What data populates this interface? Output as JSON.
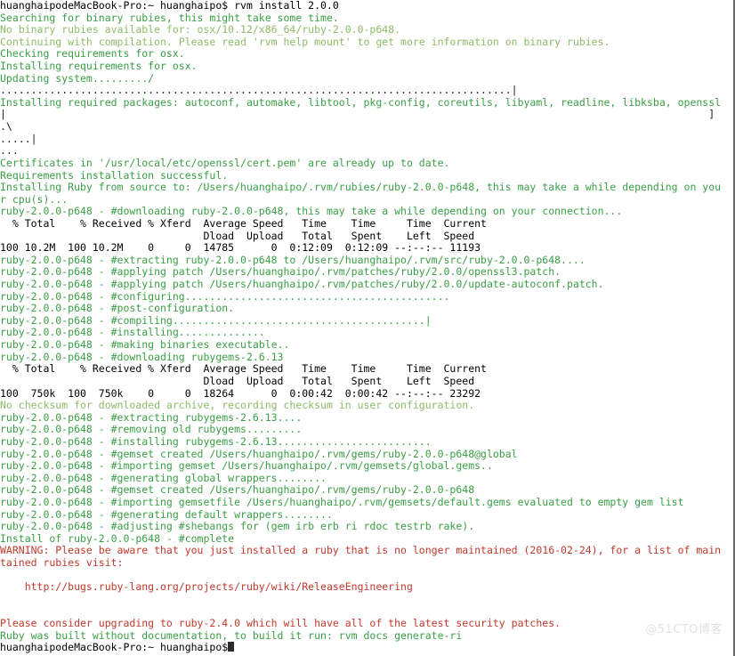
{
  "terminal": {
    "app": "Terminal",
    "prompt_user": "huanghaipo",
    "prompt_host": "huanghaipodeMacBook-Pro",
    "command": "rvm install 2.0.0",
    "watermark": "@51CTO博客",
    "colors": {
      "background": "#ffffff",
      "default_text": "#000000",
      "info_green": "#3a9e45",
      "notice_yellow_green": "#8dbb67",
      "warning_red": "#c0392b"
    },
    "lines": [
      {
        "color": "black",
        "text": "huanghaipodeMacBook-Pro:~ huanghaipo$ rvm install 2.0.0"
      },
      {
        "color": "green",
        "text": "Searching for binary rubies, this might take some time."
      },
      {
        "color": "lgreen",
        "text": "No binary rubies available for: osx/10.12/x86_64/ruby-2.0.0-p648."
      },
      {
        "color": "lgreen",
        "text": "Continuing with compilation. Please read 'rvm help mount' to get more information on binary rubies."
      },
      {
        "color": "green",
        "text": "Checking requirements for osx."
      },
      {
        "color": "green",
        "text": "Installing requirements for osx."
      },
      {
        "color": "green",
        "text": "Updating system........./"
      },
      {
        "color": "dark",
        "text": "...................................................................................|"
      },
      {
        "color": "green",
        "text": "Installing required packages: autoconf, automake, libtool, pkg-config, coreutils, libyaml, readline, libksba, openssl"
      },
      {
        "color": "dark",
        "text": "|                                                                                                                  ]"
      },
      {
        "color": "dark",
        "text": ".\\"
      },
      {
        "color": "dark",
        "text": ".....|"
      },
      {
        "color": "dark",
        "text": "..."
      },
      {
        "color": "green",
        "text": "Certificates in '/usr/local/etc/openssl/cert.pem' are already up to date."
      },
      {
        "color": "green",
        "text": "Requirements installation successful."
      },
      {
        "color": "green",
        "text": "Installing Ruby from source to: /Users/huanghaipo/.rvm/rubies/ruby-2.0.0-p648, this may take a while depending on you"
      },
      {
        "color": "green",
        "text": "r cpu(s)..."
      },
      {
        "color": "green",
        "text": "ruby-2.0.0-p648 - #downloading ruby-2.0.0-p648, this may take a while depending on your connection..."
      },
      {
        "color": "black",
        "text": "  % Total    % Received % Xferd  Average Speed   Time    Time     Time  Current"
      },
      {
        "color": "black",
        "text": "                                 Dload  Upload   Total   Spent    Left  Speed"
      },
      {
        "color": "black",
        "text": "100 10.2M  100 10.2M    0     0  14785      0  0:12:09  0:12:09 --:--:-- 11193"
      },
      {
        "color": "green",
        "text": "ruby-2.0.0-p648 - #extracting ruby-2.0.0-p648 to /Users/huanghaipo/.rvm/src/ruby-2.0.0-p648...."
      },
      {
        "color": "green",
        "text": "ruby-2.0.0-p648 - #applying patch /Users/huanghaipo/.rvm/patches/ruby/2.0.0/openssl3.patch."
      },
      {
        "color": "green",
        "text": "ruby-2.0.0-p648 - #applying patch /Users/huanghaipo/.rvm/patches/ruby/2.0.0/update-autoconf.patch."
      },
      {
        "color": "green",
        "text": "ruby-2.0.0-p648 - #configuring..........................................."
      },
      {
        "color": "green",
        "text": "ruby-2.0.0-p648 - #post-configuration."
      },
      {
        "color": "green",
        "text": "ruby-2.0.0-p648 - #compiling.........................................|"
      },
      {
        "color": "green",
        "text": "ruby-2.0.0-p648 - #installing.............."
      },
      {
        "color": "green",
        "text": "ruby-2.0.0-p648 - #making binaries executable.."
      },
      {
        "color": "green",
        "text": "ruby-2.0.0-p648 - #downloading rubygems-2.6.13"
      },
      {
        "color": "black",
        "text": "  % Total    % Received % Xferd  Average Speed   Time    Time     Time  Current"
      },
      {
        "color": "black",
        "text": "                                 Dload  Upload   Total   Spent    Left  Speed"
      },
      {
        "color": "black",
        "text": "100  750k  100  750k    0     0  18264      0  0:00:42  0:00:42 --:--:-- 23292"
      },
      {
        "color": "lgreen",
        "text": "No checksum for downloaded archive, recording checksum in user configuration."
      },
      {
        "color": "green",
        "text": "ruby-2.0.0-p648 - #extracting rubygems-2.6.13...."
      },
      {
        "color": "green",
        "text": "ruby-2.0.0-p648 - #removing old rubygems........."
      },
      {
        "color": "green",
        "text": "ruby-2.0.0-p648 - #installing rubygems-2.6.13........................."
      },
      {
        "color": "green",
        "text": "ruby-2.0.0-p648 - #gemset created /Users/huanghaipo/.rvm/gems/ruby-2.0.0-p648@global"
      },
      {
        "color": "green",
        "text": "ruby-2.0.0-p648 - #importing gemset /Users/huanghaipo/.rvm/gemsets/global.gems.."
      },
      {
        "color": "green",
        "text": "ruby-2.0.0-p648 - #generating global wrappers........"
      },
      {
        "color": "green",
        "text": "ruby-2.0.0-p648 - #gemset created /Users/huanghaipo/.rvm/gems/ruby-2.0.0-p648"
      },
      {
        "color": "green",
        "text": "ruby-2.0.0-p648 - #importing gemsetfile /Users/huanghaipo/.rvm/gemsets/default.gems evaluated to empty gem list"
      },
      {
        "color": "green",
        "text": "ruby-2.0.0-p648 - #generating default wrappers........"
      },
      {
        "color": "green",
        "text": "ruby-2.0.0-p648 - #adjusting #shebangs for (gem irb erb ri rdoc testrb rake)."
      },
      {
        "color": "green",
        "text": "Install of ruby-2.0.0-p648 - #complete"
      },
      {
        "color": "red",
        "text": "WARNING: Please be aware that you just installed a ruby that is no longer maintained (2016-02-24), for a list of main"
      },
      {
        "color": "red",
        "text": "tained rubies visit:"
      },
      {
        "color": "red",
        "text": ""
      },
      {
        "color": "red",
        "text": "    http://bugs.ruby-lang.org/projects/ruby/wiki/ReleaseEngineering"
      },
      {
        "color": "red",
        "text": ""
      },
      {
        "color": "red",
        "text": ""
      },
      {
        "color": "red",
        "text": "Please consider upgrading to ruby-2.4.0 which will have all of the latest security patches."
      },
      {
        "color": "green",
        "text": "Ruby was built without documentation, to build it run: rvm docs generate-ri"
      },
      {
        "color": "black",
        "text": "huanghaipodeMacBook-Pro:~ huanghaipo$"
      }
    ]
  }
}
